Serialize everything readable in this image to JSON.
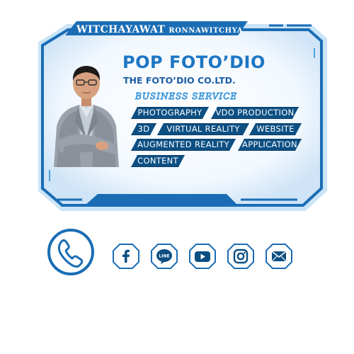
{
  "card": {
    "owner_first": "WITCHAYAWAT",
    "owner_last": "RONNAWITCHYA",
    "brand": "POP FOTO’DIO",
    "company": "THE FOTO’DIO CO.LTD.",
    "services_title": "BUSINESS SERVICE",
    "services": [
      "PHOTOGRAPHY",
      "VDO PRODUCTION",
      "3D",
      "VIRTUAL REALITY",
      "WEBSITE",
      "AUGMENTED REALITY",
      "APPLICATION",
      "CONTENT"
    ]
  },
  "contact": {
    "icons": [
      "phone-icon",
      "facebook-icon",
      "line-icon",
      "youtube-icon",
      "instagram-icon",
      "email-icon"
    ],
    "line_label": "LINE"
  },
  "colors": {
    "frame_blue": "#1a6db5",
    "dark_blue": "#0c4f83",
    "brand_blue": "#1d76c4",
    "panel_fill": "#eef6fd"
  }
}
